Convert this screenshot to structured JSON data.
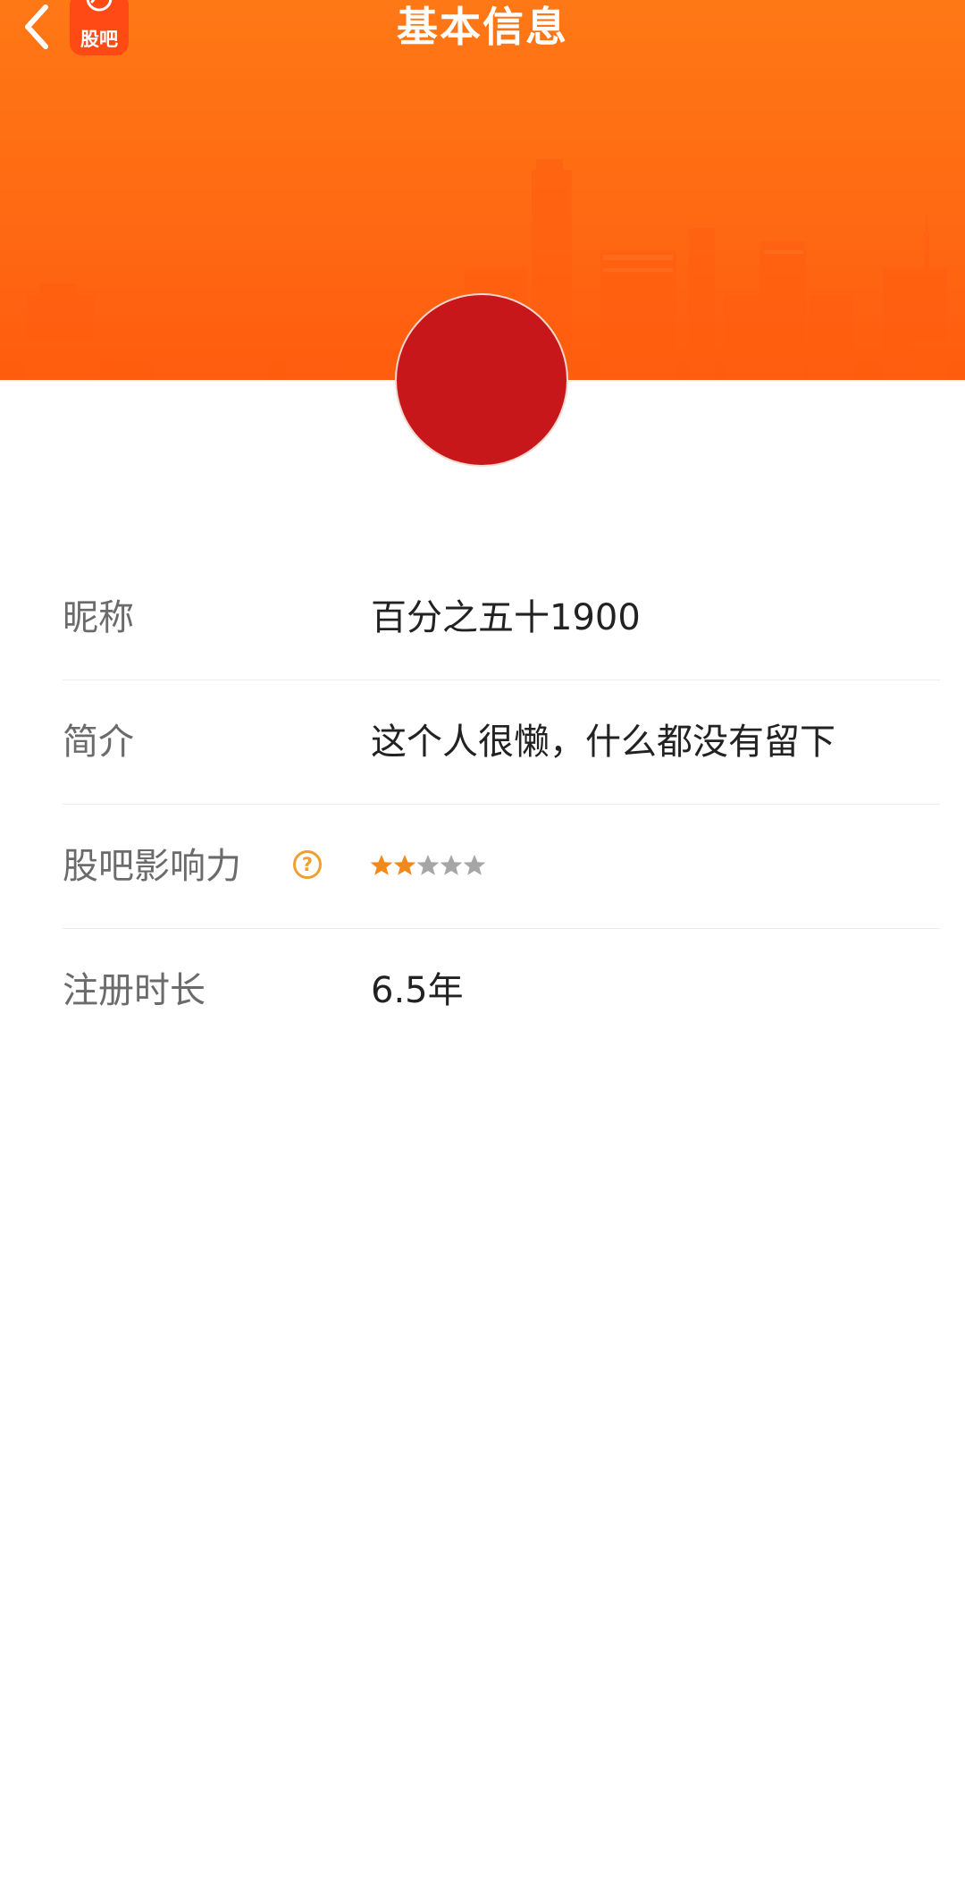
{
  "header": {
    "title": "基本信息",
    "logo_text": "股吧",
    "accent": "#ff6a12"
  },
  "profile": {
    "avatar_color": "#c8171a"
  },
  "info": {
    "nickname": {
      "label": "昵称",
      "value": "百分之五十1900"
    },
    "bio": {
      "label": "简介",
      "value": "这个人很懒，什么都没有留下"
    },
    "influence": {
      "label": "股吧影响力",
      "stars_filled": 2,
      "stars_total": 5,
      "star_color": "#f08a1c",
      "star_empty_color": "#a6a6a6"
    },
    "registration": {
      "label": "注册时长",
      "value": "6.5年"
    }
  }
}
